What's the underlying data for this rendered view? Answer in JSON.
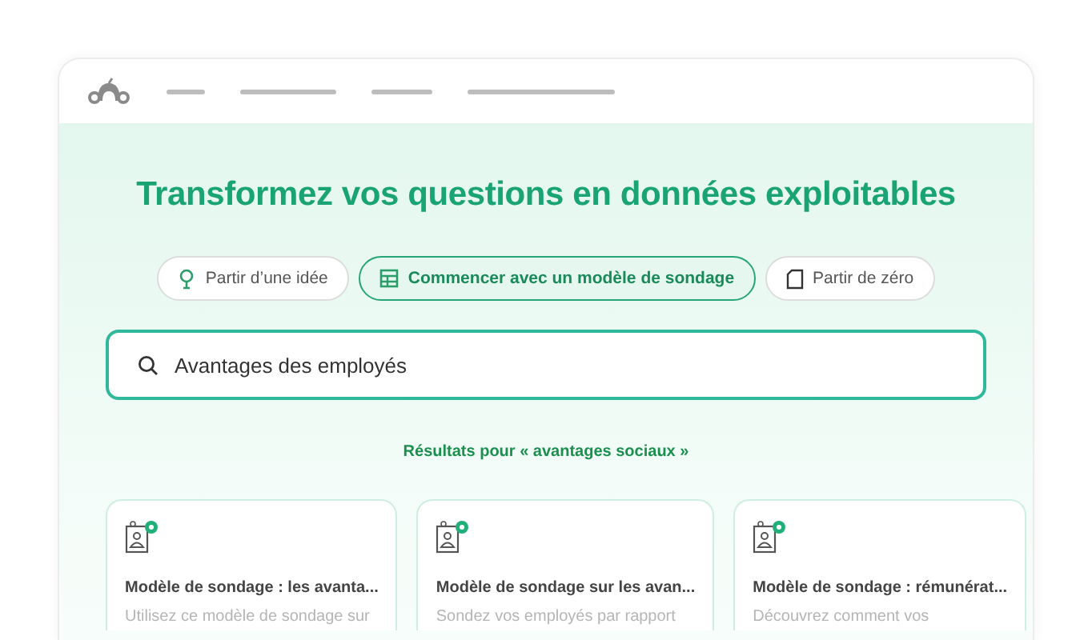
{
  "title": "Transformez vos questions en données exploitables",
  "options": [
    {
      "label": "Partir d’une idée",
      "kind": "idea",
      "selected": false
    },
    {
      "label": "Commencer avec un modèle de sondage",
      "kind": "template",
      "selected": true
    },
    {
      "label": "Partir de zéro",
      "kind": "blank",
      "selected": false
    }
  ],
  "search": {
    "value": "Avantages des employés"
  },
  "results_label": "Résultats pour « avantages sociaux »",
  "cards": [
    {
      "title": "Modèle de sondage : les avanta...",
      "description": "Utilisez ce modèle de sondage sur"
    },
    {
      "title": "Modèle de sondage sur les avan...",
      "description": "Sondez vos employés par rapport"
    },
    {
      "title": "Modèle de sondage : rémunérat...",
      "description": "Découvrez comment vos"
    }
  ]
}
